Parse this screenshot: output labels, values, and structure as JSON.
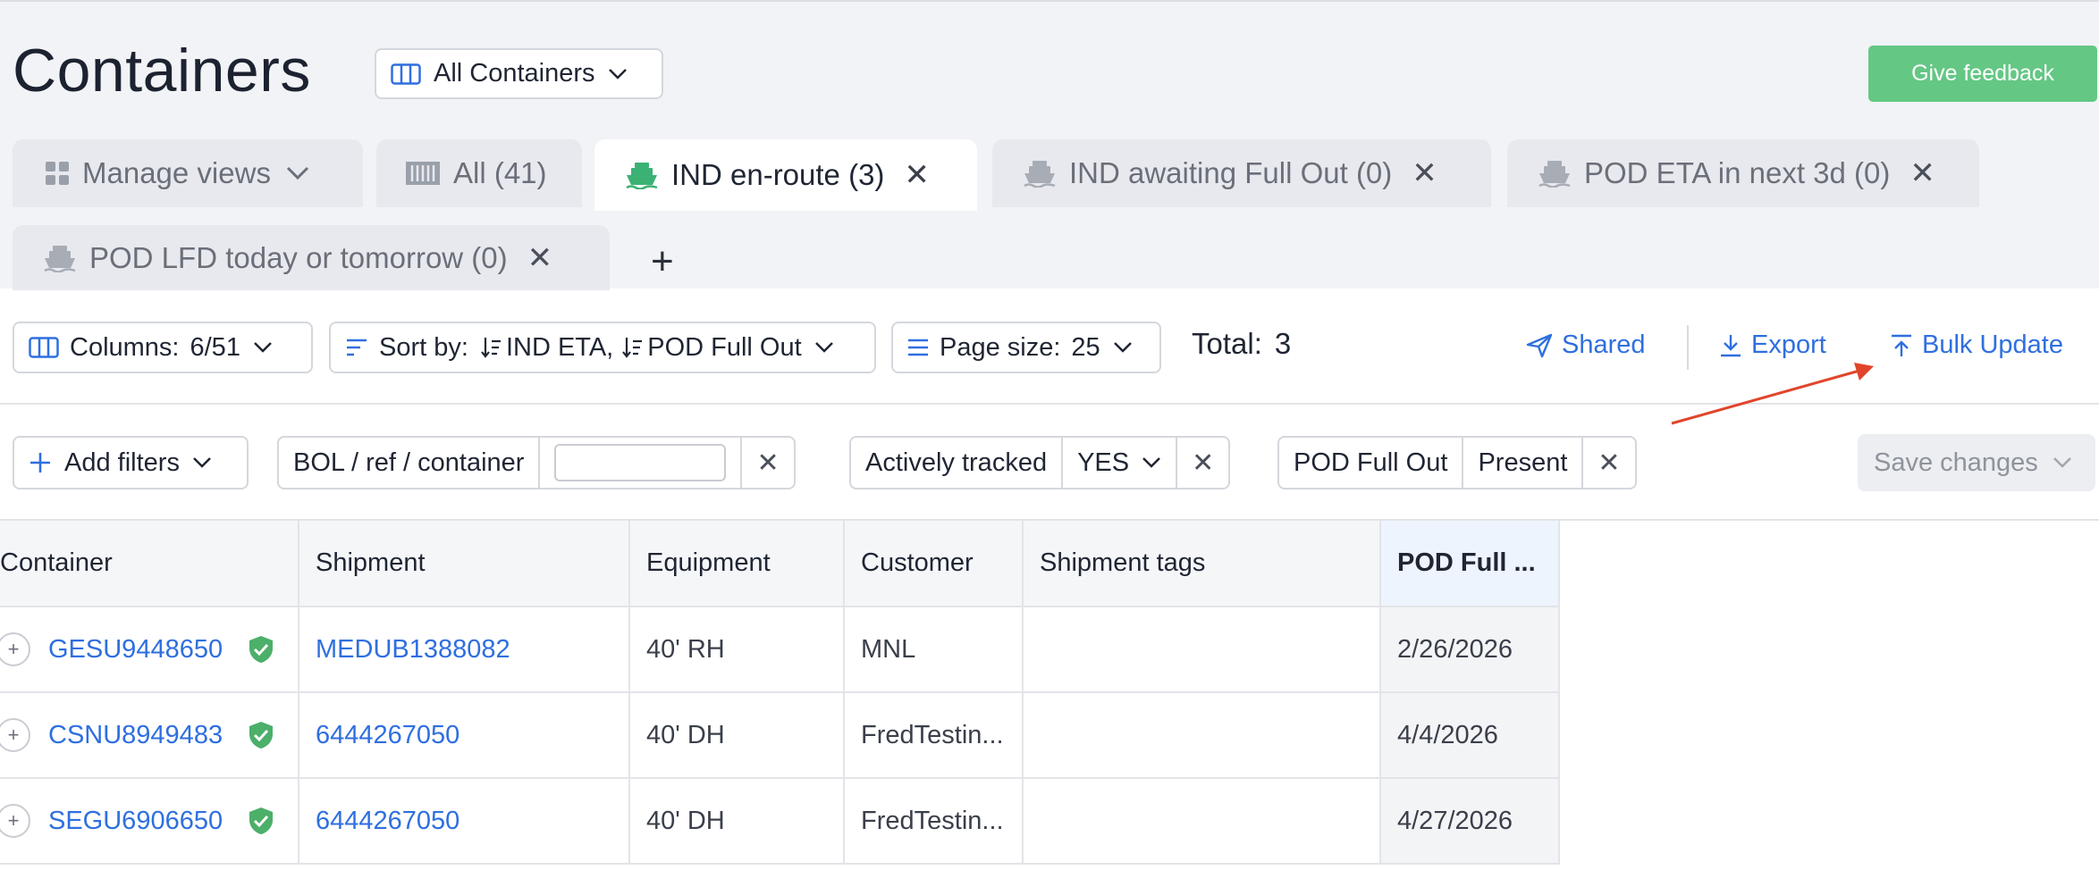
{
  "page": {
    "title": "Containers",
    "feedback_label": "Give feedback"
  },
  "view_selector": {
    "label": "All Containers"
  },
  "tabs": [
    {
      "label": "Manage views",
      "icon": "grid-icon",
      "closable": false
    },
    {
      "label": "All (41)",
      "icon": "container-icon",
      "closable": false
    },
    {
      "label": "IND en-route (3)",
      "icon": "ship-icon",
      "closable": true,
      "active": true
    },
    {
      "label": "IND awaiting Full Out (0)",
      "icon": "ship-icon",
      "closable": true
    },
    {
      "label": "POD ETA in next 3d (0)",
      "icon": "ship-icon",
      "closable": true
    },
    {
      "label": "POD LFD today or tomorrow (0)",
      "icon": "ship-icon",
      "closable": true
    }
  ],
  "add_tab_label": "+",
  "toolbar": {
    "columns_label": "Columns:",
    "columns_value": "6/51",
    "sort_label": "Sort by:",
    "sort_value_1": "IND ETA,",
    "sort_value_2": "POD Full Out",
    "page_size_label": "Page size:",
    "page_size_value": "25",
    "total_label": "Total:",
    "total_value": "3",
    "shared_label": "Shared",
    "export_label": "Export",
    "bulk_update_label": "Bulk Update"
  },
  "filters": {
    "add_label": "Add filters",
    "search_label": "BOL / ref / container",
    "search_value": "",
    "tracked_label": "Actively tracked",
    "tracked_value": "YES",
    "pod_label": "POD Full Out",
    "pod_value": "Present",
    "save_label": "Save changes"
  },
  "table": {
    "headers": [
      "Container",
      "Shipment",
      "Equipment",
      "Customer",
      "Shipment tags",
      "POD Full ..."
    ],
    "rows": [
      {
        "container": "GESU9448650",
        "shipment": "MEDUB1388082",
        "equipment": "40' RH",
        "customer": "MNL",
        "tags": "",
        "pod_full_out": "2/26/2026"
      },
      {
        "container": "CSNU8949483",
        "shipment": "6444267050",
        "equipment": "40' DH",
        "customer": "FredTestin...",
        "tags": "",
        "pod_full_out": "4/4/2026"
      },
      {
        "container": "SEGU6906650",
        "shipment": "6444267050",
        "equipment": "40' DH",
        "customer": "FredTestin...",
        "tags": "",
        "pod_full_out": "4/27/2026"
      }
    ]
  },
  "colors": {
    "accent": "#2f6fdf",
    "feedback": "#64c784",
    "ship_active": "#3bb273",
    "tracked_badge": "#4caf6a",
    "annotation_arrow": "#e0452b"
  }
}
